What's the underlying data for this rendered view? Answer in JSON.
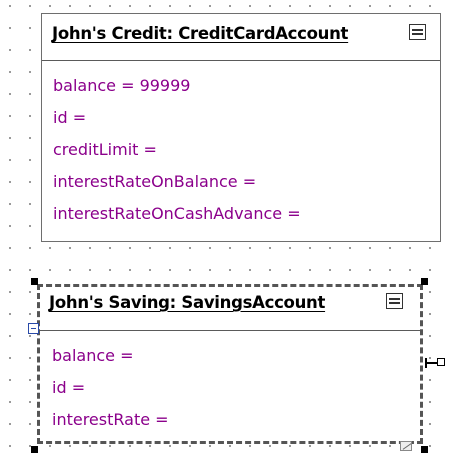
{
  "objects": [
    {
      "title": "John's Credit: CreditCardAccount",
      "attributes": [
        "balance =  99999",
        "id =",
        "creditLimit =",
        "interestRateOnBalance =",
        "interestRateOnCashAdvance ="
      ]
    },
    {
      "title": "John's Saving: SavingsAccount",
      "attributes": [
        "balance =",
        "id =",
        "interestRate ="
      ]
    }
  ],
  "colors": {
    "attribute_text": "#8b008b",
    "border": "#6e6e6e",
    "collapse_button": "#2a4aa8"
  },
  "icons": [
    "menu-icon",
    "collapse-icon",
    "port-icon",
    "resize-grip-icon"
  ]
}
